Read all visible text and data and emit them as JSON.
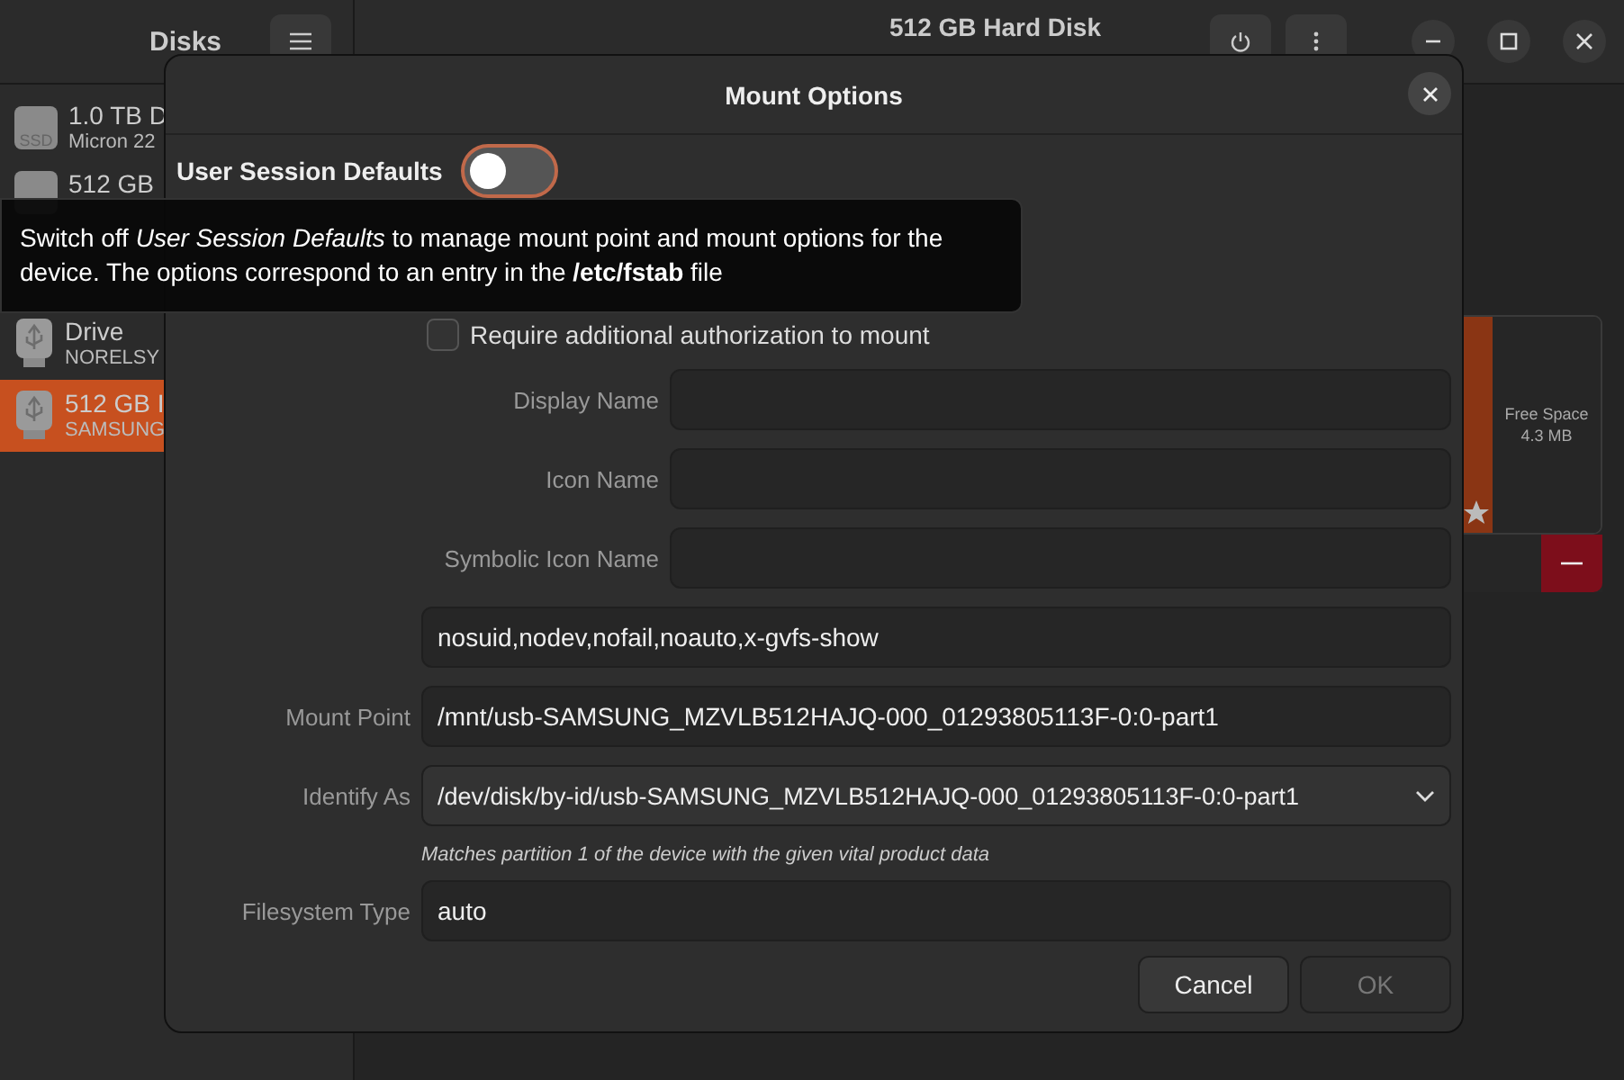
{
  "app": {
    "sidebar_title": "Disks",
    "window_title": "512 GB Hard Disk"
  },
  "sidebar": {
    "items": [
      {
        "title": "1.0 TB D",
        "subtitle": "Micron 22",
        "kind": "ssd",
        "icon_label": "SSD",
        "selected": false
      },
      {
        "title": "512 GB",
        "kind": "ssd",
        "selected": false
      },
      {
        "title": "Drive",
        "subtitle": "NORELSY",
        "kind": "usb",
        "selected": false
      },
      {
        "title": "512 GB I",
        "subtitle": "SAMSUNG",
        "kind": "usb",
        "selected": true
      }
    ]
  },
  "volume_map": {
    "free_space_label": "Free Space",
    "free_space_size": "4.3 MB"
  },
  "dialog": {
    "title": "Mount Options",
    "user_session_defaults": {
      "label": "User Session Defaults",
      "on": false
    },
    "require_auth": {
      "label": "Require additional authorization to mount",
      "checked": false
    },
    "name_fields": [
      {
        "label": "Display Name"
      },
      {
        "label": "Icon Name"
      },
      {
        "label": "Symbolic Icon Name"
      }
    ],
    "options_value": "nosuid,nodev,nofail,noauto,x-gvfs-show",
    "mount_point": {
      "label": "Mount Point",
      "value": "/mnt/usb-SAMSUNG_MZVLB512HAJQ-000_01293805113F-0:0-part1"
    },
    "identify_as": {
      "label": "Identify As",
      "value": "/dev/disk/by-id/usb-SAMSUNG_MZVLB512HAJQ-000_01293805113F-0:0-part1",
      "hint": "Matches partition 1 of the device with the given vital product data"
    },
    "filesystem_type": {
      "label": "Filesystem Type",
      "value": "auto"
    },
    "buttons": [
      {
        "label": "Cancel",
        "disabled": false
      },
      {
        "label": "OK",
        "disabled": true
      }
    ]
  },
  "tooltip": {
    "text": "Switch off *User Session Defaults* to manage mount point and mount options for the device. The options correspond to an entry in the **/etc/fstab** file"
  }
}
